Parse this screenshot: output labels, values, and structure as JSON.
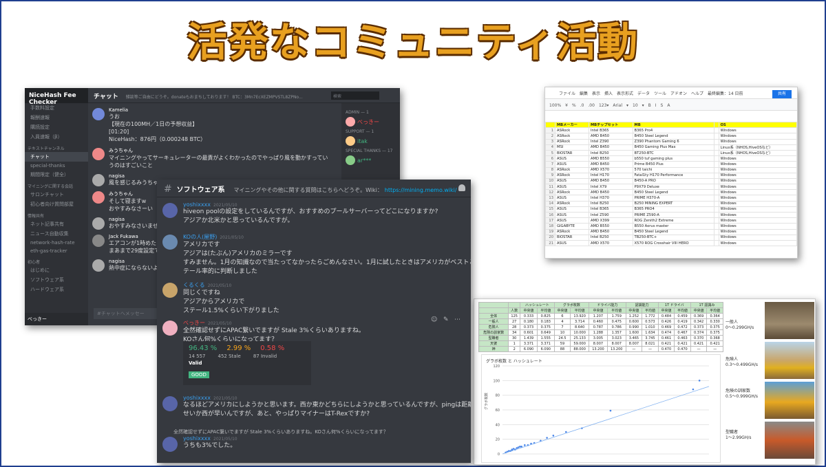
{
  "title": "活発なコミュニティ活動",
  "colors": {
    "title": "#e8a020",
    "title_outline": "#5a2c00",
    "frame": "#1f3f8f",
    "discord_bg": "#36393f",
    "sheet_header": "#ffff00",
    "good": "#43b581"
  },
  "discord_back": {
    "server": "NiceHash Fee Checker",
    "channels": [
      "手数料設定",
      "報酬速報",
      "購読設定",
      "入員速報（β）"
    ],
    "category_text": "テキストチャンネル",
    "active_channel": "チャット",
    "channels2": [
      "special-thanks",
      "期間限定（健全）"
    ],
    "category2": "マイニングに関する会話",
    "channels3": [
      "サロンチャット",
      "初心者向け質問部屋"
    ],
    "category3": "情報共有",
    "channels4": [
      "ネット記事共有",
      "ニュース自動収集",
      "network-hash-rate",
      "eth-gas-tracker"
    ],
    "category4": "初心者",
    "channels5": [
      "はじめに",
      "ソフトウェア系",
      "ハードウェア系"
    ],
    "channel_title": "チャット",
    "topic": "雑談等ご自由にどうぞ。donateもおまちしております！ BTC：3Mn7EcXEZMPVSTL8ZPNo...",
    "search": "検索",
    "messages": [
      {
        "name": "Kamelia",
        "lines": [
          "うお",
          "【現在の100MH／1日の予想収益】",
          "[01:20]",
          "NiceHash：876円（0.000248 BTC）"
        ]
      },
      {
        "name": "みうちゃん",
        "lines": [
          "マイニングやってサーキュレーターの最責がよくわかったのでやっぱり風を動かすっていうのはすごいこと"
        ]
      },
      {
        "name": "nagisa",
        "lines": [
          "風を感じるみうちゃん"
        ]
      },
      {
        "name": "みうちゃん",
        "lines": [
          "そして寝ますw",
          "おやすみなさーい"
        ]
      },
      {
        "name": "nagisa",
        "lines": [
          "おやすみなさいませ"
        ]
      },
      {
        "name": "Jack Fukawa",
        "lines": [
          "エアコンが1時めたら",
          "まあまで29度設定で"
        ]
      },
      {
        "name": "nagisa",
        "lines": [
          "熱中症にならないよう"
        ]
      }
    ],
    "admin_head": "ADMIN — 1",
    "admin": "べっきー",
    "support_head": "SUPPORT — 1",
    "support": "itak",
    "thanks_head": "SPECIAL THANKS — 17",
    "thanks": "ar***",
    "input": "#チャットへメッセー",
    "user": "べっきー"
  },
  "discord_front": {
    "channel": "ソフトウェア系",
    "topic": "マイニングやその他に関する質問はこちらへどうぞ。Wiki：",
    "link": "https://mining.memo.wiki/",
    "messages": [
      {
        "name": "yoshixxxx",
        "time": "2021/05/10",
        "lines": [
          "hiveon poolの設定をしているんですが、おすすめのプールサーバーってどこになりますか?",
          "アジアか北米かと思っているんですが。"
        ]
      },
      {
        "name": "KOの人(屋野)",
        "time": "2021/05/10",
        "lines": [
          "アメリカです",
          "アジアは(たぶん)アメリカのミラーです",
          "すみません。1月の知識なので当たってなかったらごめんなさい。1月に試したときはアメリカがベストとス",
          "テール率的に判断しました"
        ]
      },
      {
        "name": "くるくる",
        "time": "2021/05/10",
        "lines": [
          "同じくですね",
          "アジアからアメリカで",
          "ステール1.5%くらい下がりました"
        ]
      },
      {
        "name": "べっきー",
        "time": "2021/05/10",
        "lines": [
          "全然確認せずにAPAC繋いでますが Stale 3%くらいありますね。",
          "KOさん何%くらいになってます？"
        ]
      },
      {
        "name": "yoshixxxx",
        "time": "2021/05/10",
        "lines": [
          "なるほどアメリカにしようかと思います。西か東かどちらにしようかと思っているんですが、pingは距離の",
          "せいか西が早いんですが、あと、やっぱりマイナーはT-Rexですか?"
        ]
      },
      {
        "name": "yoshixxxx",
        "time": "2021/05/10",
        "lines": [
          "うちも3%でした。"
        ]
      }
    ],
    "poll": {
      "valid_pct": "96.43 %",
      "stale_pct": "2.99 %",
      "invalid_pct": "0.58 %",
      "valid_n": "14 557",
      "stale_n": "452 Stale",
      "invalid_n": "87 Invalid",
      "valid_label": "Valid",
      "good": "GOOD"
    },
    "reply": "全然確認せずにAPAC繋いでますが Stale 3%くらいありますね。KOさん何%くらいになってます？"
  },
  "sheet": {
    "menu": "ファイル　編集　表示　挿入　表示形式　データ　ツール　アドオン　ヘルプ　最終編集：14 日前",
    "toolbar": "100%　¥　%　.0　.00　123▾　Arial　▾　10　▾　B　I　S　A",
    "share": "共有",
    "columns": [
      "MBメーカー",
      "MBチップセット",
      "MB",
      "",
      "OS"
    ],
    "rows": [
      [
        "ASRock",
        "Intel B365",
        "B365 Pro4",
        "",
        "Windows"
      ],
      [
        "ASRock",
        "AMD B450",
        "B450 Steel Legend",
        "",
        "Windows"
      ],
      [
        "ASRock",
        "Intel Z390",
        "Z390 Phantom Gaming 6",
        "",
        "Windows"
      ],
      [
        "MSI",
        "AMD B450",
        "B450 Gaming Plus Max",
        "",
        "Linux系（NHOS,HiveOSなど）"
      ],
      [
        "BIOSTAR",
        "Intel B250",
        "BT250-BTC",
        "",
        "Linux系（NHOS,HiveOSなど）"
      ],
      [
        "ASUS",
        "AMD B550",
        "b550 tuf gaming plus",
        "",
        "Windows"
      ],
      [
        "ASUS",
        "AMD B450",
        "Prime B450 Plus",
        "",
        "Windows"
      ],
      [
        "ASRock",
        "AMD X570",
        "570 taichi",
        "",
        "Windows"
      ],
      [
        "ASRock",
        "Intel H170",
        "Fatal1ty H170 Performance",
        "",
        "Windows"
      ],
      [
        "ASUS",
        "AMD B450",
        "B450-A PRO",
        "",
        "Windows"
      ],
      [
        "ASUS",
        "Intel X79",
        "P9X79 Deluxe",
        "",
        "Windows"
      ],
      [
        "ASRock",
        "AMD B450",
        "B450 Steel Legend",
        "",
        "Windows"
      ],
      [
        "ASUS",
        "Intel H370",
        "PRIME H370-A",
        "",
        "Windows"
      ],
      [
        "ASRock",
        "Intel B250",
        "B250 MINING EXPERT",
        "",
        "Windows"
      ],
      [
        "ASUS",
        "Intel B365",
        "B365 PRO4",
        "",
        "Windows"
      ],
      [
        "ASUS",
        "Intel Z590",
        "PRIME Z590-A",
        "",
        "Windows"
      ],
      [
        "ASUS",
        "AMD X399",
        "ROG Zenith2 Extreme",
        "",
        "Windows"
      ],
      [
        "GIGABYTE",
        "AMD B550",
        "B550 Aorus master",
        "",
        "Windows"
      ],
      [
        "ASRock",
        "AMD B450",
        "B450 Steel Legend",
        "",
        "Windows"
      ],
      [
        "BIOSTAR",
        "Intel B250",
        "TB250-BTC+",
        "",
        "Windows"
      ],
      [
        "ASUS",
        "AMD X570",
        "X570 ROG Crosshair VIII HERO",
        "",
        "Windows"
      ]
    ]
  },
  "stats": {
    "headers": [
      "",
      "",
      "ハッシュレート",
      "",
      "グラボ枚数",
      "",
      "ドライバ能力",
      "",
      "認識能力",
      "",
      "1T ドライバ",
      "",
      "1T 認識み"
    ],
    "sub": [
      "",
      "人数",
      "中央値",
      "平均値",
      "中央値",
      "平均値",
      "中央値",
      "平均値",
      "中央値",
      "平均値",
      "中央値",
      "平均値",
      "中央値",
      "平均値"
    ],
    "rows": [
      [
        "全体",
        "125",
        "0.333",
        "0.825",
        "6",
        "13.920",
        "1.207",
        "1.759",
        "1.252",
        "1.772",
        "0.484",
        "0.459",
        "0.369",
        "0.364"
      ],
      [
        "一般人",
        "27",
        "0.180",
        "0.183",
        "4",
        "3.714",
        "0.460",
        "0.475",
        "0.600",
        "0.573",
        "0.426",
        "0.419",
        "0.342",
        "0.330"
      ],
      [
        "危険人",
        "28",
        "0.373",
        "0.375",
        "7",
        "8.640",
        "0.787",
        "0.786",
        "0.990",
        "1.010",
        "0.469",
        "0.472",
        "0.373",
        "0.375"
      ],
      [
        "危険の訓家数",
        "34",
        "0.601",
        "0.649",
        "10",
        "10.000",
        "1.288",
        "1.357",
        "1.600",
        "1.634",
        "0.474",
        "0.467",
        "0.374",
        "0.375"
      ],
      [
        "型職者",
        "30",
        "1.439",
        "1.555",
        "24.5",
        "25.133",
        "3.005",
        "3.023",
        "3.465",
        "3.745",
        "0.461",
        "0.463",
        "0.370",
        "0.368"
      ],
      [
        "天彼",
        "1",
        "3.371",
        "3.371",
        "59",
        "59.000",
        "8.007",
        "8.007",
        "8.007",
        "8.021",
        "0.421",
        "0.421",
        "0.421",
        "0.421"
      ],
      [
        "神",
        "2",
        "6.090",
        "6.090",
        "88",
        "88.000",
        "13.200",
        "13.200",
        "—",
        "—",
        "0.470",
        "0.470",
        "—",
        "—"
      ]
    ],
    "chart_title": "グラボ枚数 と ハッシュレート",
    "labels": [
      {
        "name": "一般人",
        "range": "0〜0.299GH/s"
      },
      {
        "name": "危険人",
        "range": "0.3〜0.499GH/s"
      },
      {
        "name": "危険の訓家数",
        "range": "0.5〜0.999GH/s"
      },
      {
        "name": "型職者",
        "range": "1〜2.99GH/s"
      }
    ],
    "y_ticks": [
      "120",
      "100",
      "80",
      "60",
      "40",
      "20",
      "0"
    ]
  },
  "chart_data": {
    "type": "scatter",
    "title": "グラボ枚数 と ハッシュレート",
    "xlabel": "",
    "ylabel": "グラボ枚数",
    "ylim": [
      0,
      120
    ],
    "points": [
      [
        0.1,
        2
      ],
      [
        0.15,
        3
      ],
      [
        0.2,
        4
      ],
      [
        0.25,
        4
      ],
      [
        0.3,
        5
      ],
      [
        0.3,
        6
      ],
      [
        0.35,
        7
      ],
      [
        0.4,
        6
      ],
      [
        0.45,
        8
      ],
      [
        0.5,
        9
      ],
      [
        0.55,
        10
      ],
      [
        0.6,
        10
      ],
      [
        0.7,
        12
      ],
      [
        0.8,
        12
      ],
      [
        0.9,
        14
      ],
      [
        1.0,
        15
      ],
      [
        1.2,
        18
      ],
      [
        1.4,
        22
      ],
      [
        1.6,
        25
      ],
      [
        2.0,
        30
      ],
      [
        2.5,
        35
      ],
      [
        3.4,
        59
      ],
      [
        6.0,
        88
      ],
      [
        6.2,
        100
      ]
    ]
  }
}
